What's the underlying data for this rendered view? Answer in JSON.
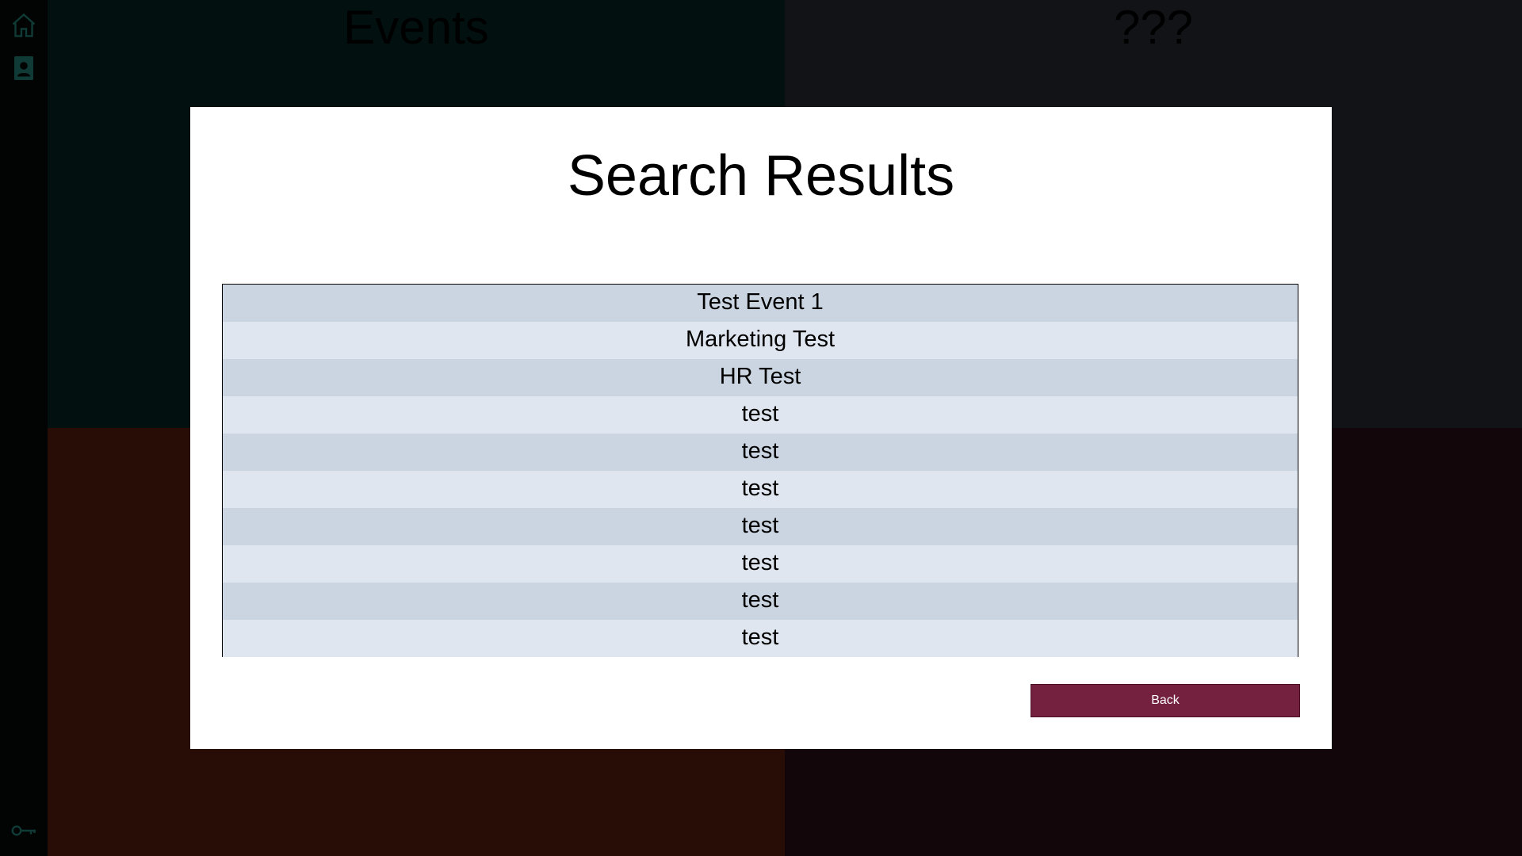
{
  "tiles": [
    {
      "title": "Events",
      "color": "#021010"
    },
    {
      "title": "???",
      "color": "#111316"
    },
    {
      "title": "",
      "color": "#280d06"
    },
    {
      "title": "",
      "color": "#12060b"
    }
  ],
  "sidebar": {
    "icons": [
      "home-icon",
      "contact-icon",
      "key-icon"
    ],
    "icon_color": "#0f3a35"
  },
  "modal": {
    "title": "Search Results",
    "results": [
      "Test Event 1",
      "Marketing Test",
      "HR Test",
      "test",
      "test",
      "test",
      "test",
      "test",
      "test",
      "test"
    ],
    "back_label": "Back",
    "back_color": "#74213f"
  }
}
